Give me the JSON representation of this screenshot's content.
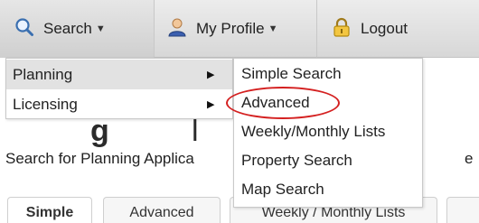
{
  "navbar": {
    "search_label": "Search",
    "profile_label": "My Profile",
    "logout_label": "Logout"
  },
  "submenu": {
    "items": [
      {
        "label": "Planning",
        "has_children": true,
        "active": true
      },
      {
        "label": "Licensing",
        "has_children": true,
        "active": false
      }
    ]
  },
  "flyout": {
    "items": [
      {
        "label": "Simple Search"
      },
      {
        "label": "Advanced",
        "highlighted": true
      },
      {
        "label": "Weekly/Monthly Lists"
      },
      {
        "label": "Property Search"
      },
      {
        "label": "Map Search"
      }
    ]
  },
  "page": {
    "heading_fragment_left": "g",
    "heading_fragment_right": "l",
    "description": "Search for Planning Applica",
    "description_tail": "e"
  },
  "tabs": [
    {
      "label": "Simple",
      "selected": true
    },
    {
      "label": "Advanced",
      "selected": false
    },
    {
      "label": "Weekly / Monthly Lists",
      "selected": false
    }
  ],
  "colors": {
    "highlight": "#d42020",
    "search_icon": "#3a6fb0",
    "navbar_bg": "#dedede"
  }
}
